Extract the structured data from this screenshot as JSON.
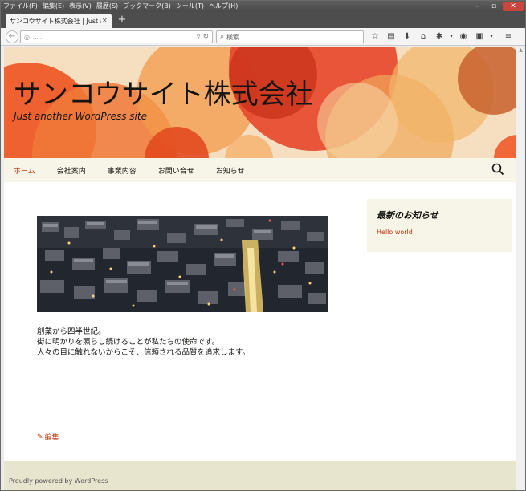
{
  "menubar": {
    "items": [
      "ファイル(F)",
      "編集(E)",
      "表示(V)",
      "履歴(S)",
      "ブックマーク(B)",
      "ツール(T)",
      "ヘルプ(H)"
    ]
  },
  "tab": {
    "title": "サンコウサイト株式会社 | Just a...",
    "close": "×",
    "new": "+"
  },
  "toolbar": {
    "url_text": "......",
    "search_placeholder": "検索"
  },
  "site": {
    "title": "サンコウサイト株式会社",
    "description": "Just another WordPress site"
  },
  "nav": {
    "items": [
      "ホーム",
      "会社案内",
      "事業内容",
      "お問い合せ",
      "お知らせ"
    ]
  },
  "content": {
    "lines": [
      "創業から四半世紀。",
      "街に明かりを照らし続けることが私たちの使命です。",
      "人々の目に触れないからこそ、信頼される品質を追求します。"
    ],
    "edit": "編集"
  },
  "widget": {
    "title": "最新のお知らせ",
    "link": "Hello world!"
  },
  "footer": {
    "text": "Proudly powered by WordPress"
  },
  "colors": {
    "accent": "#bc360a",
    "nav_bg": "#f7f5e7",
    "footer_bg": "#e8e5ce"
  }
}
